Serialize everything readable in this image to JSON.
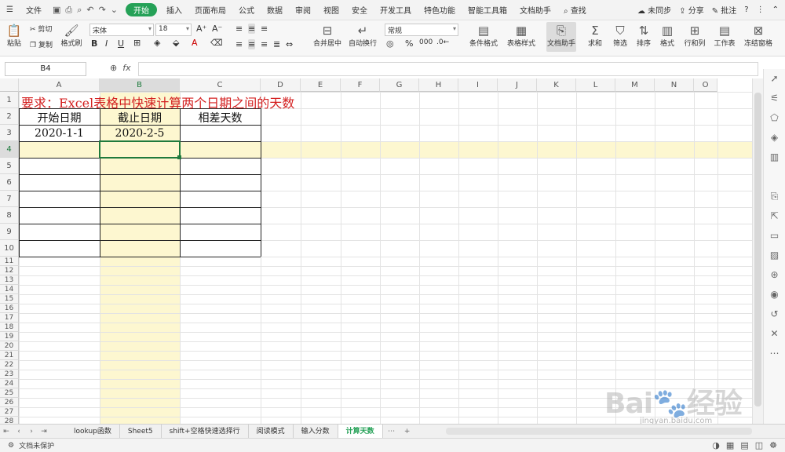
{
  "menubar": {
    "file": "文件",
    "tabs": [
      "开始",
      "插入",
      "页面布局",
      "公式",
      "数据",
      "审阅",
      "视图",
      "安全",
      "开发工具",
      "特色功能",
      "智能工具箱",
      "文档助手"
    ],
    "active_tab": "开始",
    "search": "查找",
    "sync": "未同步",
    "share": "分享",
    "comment": "批注"
  },
  "ribbon": {
    "paste": "粘贴",
    "cut": "剪切",
    "copy": "复制",
    "format_painter": "格式刷",
    "font_name": "宋体",
    "font_size": "18",
    "merge_center": "合并居中",
    "auto_wrap": "自动换行",
    "number_format": "常规",
    "cond_format": "条件格式",
    "table_style": "表格样式",
    "doc_assistant": "文档助手",
    "sum": "求和",
    "filter": "筛选",
    "sort": "排序",
    "format": "格式",
    "row_col": "行和列",
    "worksheet": "工作表",
    "freeze": "冻结窗格"
  },
  "formula": {
    "name_box": "B4",
    "fx": "fx",
    "content": ""
  },
  "sheet": {
    "columns": [
      "A",
      "B",
      "C",
      "D",
      "E",
      "F",
      "G",
      "H",
      "I",
      "J",
      "K",
      "L",
      "M",
      "N",
      "O"
    ],
    "rows": [
      "1",
      "2",
      "3",
      "4",
      "5",
      "6",
      "7",
      "8",
      "9",
      "10",
      "11",
      "12",
      "13",
      "14",
      "15",
      "16",
      "17",
      "18",
      "19",
      "20",
      "21",
      "22",
      "23",
      "24",
      "25",
      "26",
      "27",
      "28"
    ],
    "selected_cell": "B4",
    "a1": "要求：Excel表格中快速计算两个日期之间的天数",
    "a2": "开始日期",
    "b2": "截止日期",
    "c2": "相差天数",
    "a3": "2020-1-1",
    "b3": "2020-2-5"
  },
  "tabs": {
    "sheets": [
      "lookup函数",
      "Sheet5",
      "shift+空格快速选择行",
      "阅读模式",
      "输入分数",
      "计算天数"
    ],
    "active": "计算天数"
  },
  "status": {
    "protect": "文档未保护"
  },
  "watermark": {
    "logo": "Bai 经验",
    "url": "jingyan.baidu.com"
  },
  "colors": {
    "accent": "#25a157",
    "title_red": "#d42020",
    "highlight_yellow": "#fdf7d0"
  }
}
